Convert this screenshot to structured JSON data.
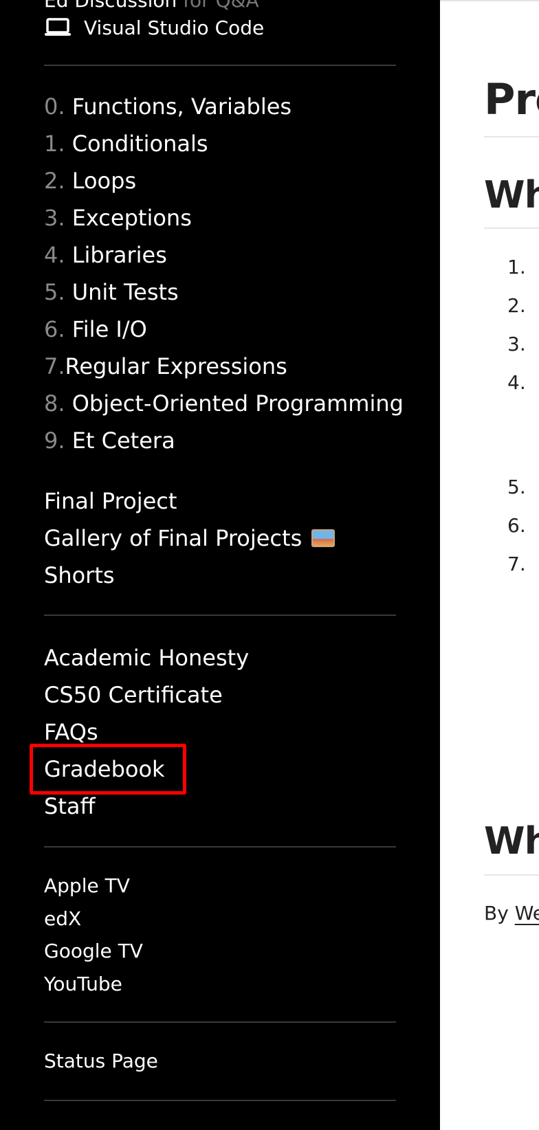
{
  "sidebar": {
    "top_partial": {
      "text": "Ed Discussion",
      "muted": "for Q&A"
    },
    "vscode": {
      "label": "Visual Studio Code",
      "icon": "laptop-icon"
    },
    "lectures": [
      {
        "num": "0.",
        "label": "Functions, Variables"
      },
      {
        "num": "1.",
        "label": "Conditionals"
      },
      {
        "num": "2.",
        "label": "Loops"
      },
      {
        "num": "3.",
        "label": "Exceptions"
      },
      {
        "num": "4.",
        "label": "Libraries"
      },
      {
        "num": "5.",
        "label": "Unit Tests"
      },
      {
        "num": "6.",
        "label": "File I/O"
      },
      {
        "num": "7.",
        "label": "Regular Expressions"
      },
      {
        "num": "8.",
        "label": "Object-Oriented Programming"
      },
      {
        "num": "9.",
        "label": "Et Cetera"
      }
    ],
    "projects": [
      {
        "label": "Final Project"
      },
      {
        "label": "Gallery of Final Projects",
        "icon": "framed-picture-icon"
      },
      {
        "label": "Shorts"
      }
    ],
    "info": [
      {
        "label": "Academic Honesty"
      },
      {
        "label": "CS50 Certificate"
      },
      {
        "label": "FAQs"
      },
      {
        "label": "Gradebook",
        "highlighted": true
      },
      {
        "label": "Staff"
      }
    ],
    "platforms": [
      {
        "label": "Apple TV"
      },
      {
        "label": "edX"
      },
      {
        "label": "Google TV"
      },
      {
        "label": "YouTube"
      }
    ],
    "status": [
      {
        "label": "Status Page"
      }
    ]
  },
  "main": {
    "title": "Pro",
    "section1": "Wh",
    "list_numbers": [
      "1.",
      "2.",
      "3.",
      "4.",
      "5.",
      "6.",
      "7."
    ],
    "section2": "Wh",
    "byline_prefix": "By",
    "byline_link": "We"
  },
  "colors": {
    "sidebar_bg": "#000000",
    "muted_number": "#8a8a8a",
    "highlight_box": "#ff0000"
  }
}
